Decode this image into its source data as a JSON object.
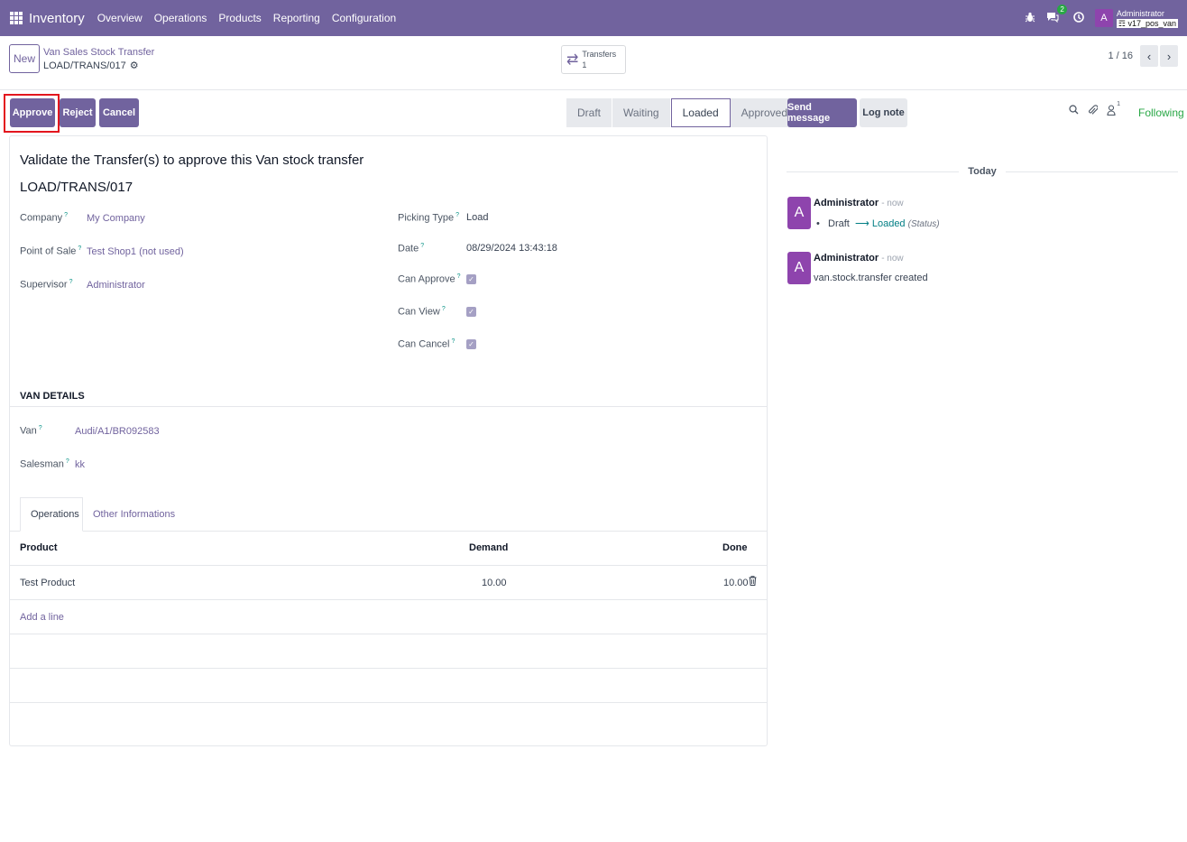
{
  "navbar": {
    "app_name": "Inventory",
    "menus": [
      "Overview",
      "Operations",
      "Products",
      "Reporting",
      "Configuration"
    ],
    "messages_count": "2",
    "avatar_letter": "A",
    "user_name": "Administrator",
    "db_name": "v17_pos_van",
    "icons": [
      "apps-grid-icon",
      "bug-icon",
      "chat-icon",
      "clock-icon"
    ]
  },
  "control_panel": {
    "new_label": "New",
    "breadcrumb_parent": "Van Sales Stock Transfer",
    "breadcrumb_current": "LOAD/TRANS/017",
    "smart_button_label": "Transfers",
    "smart_button_count": "1",
    "pager_value": "1 / 16"
  },
  "actions": {
    "approve": "Approve",
    "reject": "Reject",
    "cancel": "Cancel"
  },
  "stages": [
    "Draft",
    "Waiting",
    "Loaded",
    "Approved"
  ],
  "active_stage": "Loaded",
  "form": {
    "title": "Validate the Transfer(s) to approve this Van stock transfer",
    "reference": "LOAD/TRANS/017",
    "company_label": "Company",
    "company_value": "My Company",
    "pos_label": "Point of Sale",
    "pos_value": "Test Shop1 (not used)",
    "supervisor_label": "Supervisor",
    "supervisor_value": "Administrator",
    "picking_type_label": "Picking Type",
    "picking_type_value": "Load",
    "date_label": "Date",
    "date_value": "08/29/2024 13:43:18",
    "can_approve_label": "Can Approve",
    "can_view_label": "Can View",
    "can_cancel_label": "Can Cancel",
    "help_mark": "?",
    "van_section": "VAN DETAILS",
    "van_label": "Van",
    "van_value": "Audi/A1/BR092583",
    "salesman_label": "Salesman",
    "salesman_value": "kk"
  },
  "tabs": [
    "Operations",
    "Other Informations"
  ],
  "table": {
    "headers": [
      "Product",
      "Demand",
      "Done"
    ],
    "rows": [
      {
        "product": "Test Product",
        "demand": "10.00",
        "done": "10.00"
      }
    ],
    "add_line": "Add a line"
  },
  "chatter": {
    "send_message": "Send message",
    "log_note": "Log note",
    "followers_count": "1",
    "following": "Following",
    "today": "Today",
    "messages": [
      {
        "avatar": "A",
        "author": "Administrator",
        "time": "- now",
        "from": "Draft",
        "to": "Loaded",
        "field": "(Status)"
      },
      {
        "avatar": "A",
        "author": "Administrator",
        "time": "- now",
        "body": "van.stock.transfer created"
      }
    ]
  },
  "colors": {
    "brand": "#71639e",
    "highlight": "#e3161e",
    "following": "#28a745",
    "avatar": "#8e44ad"
  }
}
